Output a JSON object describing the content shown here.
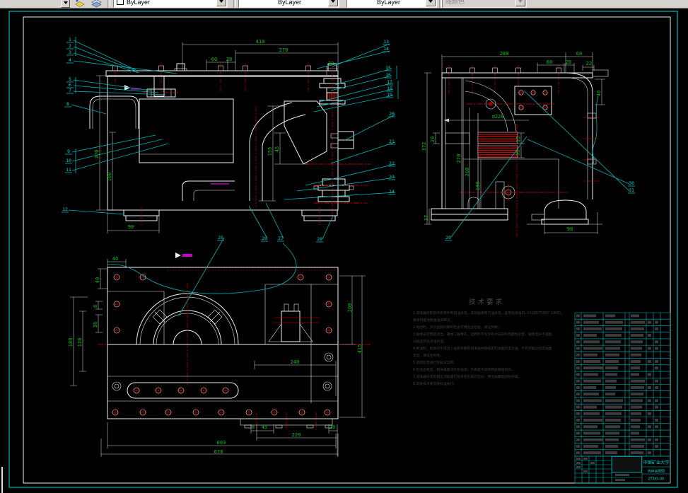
{
  "toolbar": {
    "color_control": "ByLayer",
    "linetype_control": "ByLayer",
    "lineweight_control": "ByLayer",
    "plot_style_control": "随颜色"
  },
  "drawing": {
    "callouts": [
      "1",
      "2",
      "3",
      "4",
      "5",
      "6",
      "7",
      "8",
      "9",
      "10",
      "11",
      "12",
      "13",
      "14",
      "15",
      "16",
      "17",
      "18",
      "19",
      "20",
      "21",
      "22",
      "23",
      "24",
      "25",
      "26",
      "27",
      "28",
      "29",
      "30",
      "31"
    ],
    "dims": {
      "front": [
        "410",
        "270",
        "60",
        "20",
        "22",
        "270",
        "160",
        "155",
        "45",
        "90"
      ],
      "side": [
        "280",
        "60",
        "60",
        "20",
        "22",
        "40",
        "372",
        "20",
        "270",
        "200",
        "130",
        "∅220",
        "35",
        "35",
        "37",
        "90"
      ],
      "plan": [
        "40",
        "40",
        "8",
        "36",
        "180",
        "120",
        "200",
        "415",
        "240",
        "8",
        "45",
        "20",
        "220",
        "603",
        "678"
      ]
    },
    "tech_requirements": {
      "title": "技术要求",
      "lines": [
        "1.减速器装配前所有零件用煤油清洗，滚动轴承用汽油清洗，选用润滑油ZL-U-I(GB/T5867-1986)，",
        "  箱体内壁涂耐油油漆两次。",
        "2.啮合时，对于齿侧间隙的检查可用铅丝检验，保证侧隙。",
        "3.轴承安装预紧适当，箱体二轴承孔，运转时不允许有冲击声和周期性杂音，轴承温升不得超",
        "  过规定的允许温升值。",
        "4.换油时，机体内不得注入含有杂质的润滑油并按规定的油面高度注油，不允许超过规定油面",
        "  高度，保证密封性。",
        "5.装配后需进行空载试运转。",
        "6.检验合格后，箱体表面涂灰色油漆，外表面不得有明显磕碰损伤。",
        "7.减速器安装时留出顶起螺钉及吊装孔操作空间，伸出轴端需加防护罩。",
        "8.其余技术要求按标准执行。"
      ]
    },
    "title_block": {
      "university": "中国矿业大学",
      "drawing_title": "壳体装配图",
      "drawing_no": "ZT00-00"
    },
    "colors": {
      "frame": "#00b8b8",
      "dimension_text": "#00c400",
      "hatch": "#e00000",
      "geometry": "#f0f0f0"
    }
  }
}
